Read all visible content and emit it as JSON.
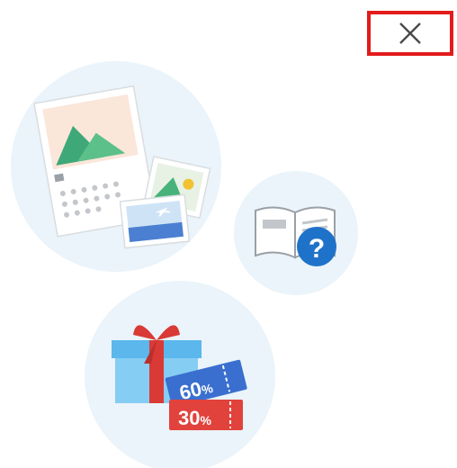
{
  "dialog": {
    "close_icon": "close-icon"
  },
  "illustrations": {
    "calendar": {
      "icons": [
        "photo-calendar-icon",
        "photo-print-icon",
        "travel-photo-icon"
      ]
    },
    "guide": {
      "icons": [
        "open-book-icon",
        "help-question-icon"
      ],
      "badge_text": "?"
    },
    "offers": {
      "icons": [
        "gift-box-icon",
        "coupon-icon"
      ],
      "coupon_top": "60",
      "coupon_bottom": "30",
      "percent_sign": "%"
    }
  },
  "colors": {
    "bubble_bg": "#eaf4fa",
    "accent_blue": "#1f72c9",
    "close_border": "#e31b1b",
    "coupon_red": "#e2423c",
    "coupon_blue": "#3a6fcf",
    "mountain_green": "#47b27a"
  }
}
